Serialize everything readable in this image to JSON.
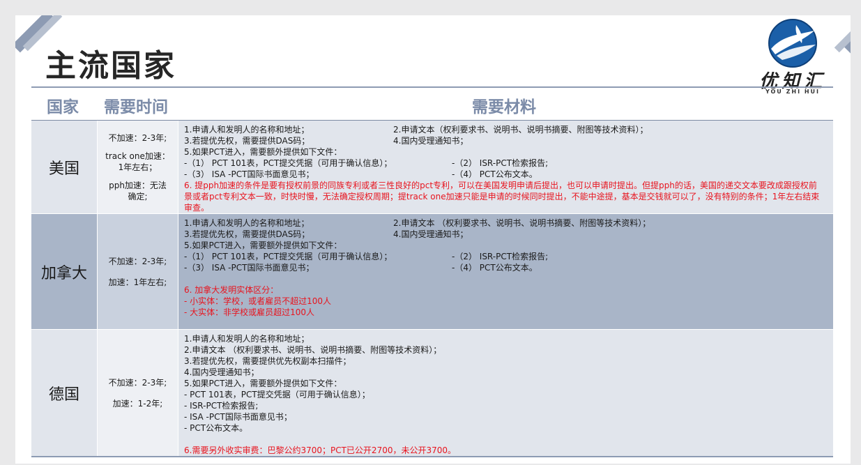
{
  "title": "主流国家",
  "logo": {
    "text": "优知汇",
    "sub": "YOU ZHI HUI"
  },
  "header": {
    "country": "国家",
    "time": "需要时间",
    "materials": "需要材料"
  },
  "rows": {
    "us": {
      "country": "美国",
      "time": [
        "不加速：2-3年;",
        "track one加速：",
        "1年左右；",
        "pph加速：无法",
        "确定;"
      ],
      "lines": [
        [
          "1.申请人和发明人的名称和地址；",
          "2.申请文本（权利要求书、说明书、说明书摘要、附图等技术资料）；"
        ],
        [
          "3.若提优先权，需要提供DAS码；",
          "4.国内受理通知书；"
        ],
        [
          "5.如果PCT进入，需要额外提供如下文件：",
          ""
        ],
        [
          " -（1） PCT 101表，PCT提交凭据（可用于确认信息）；",
          "-（2） ISR-PCT检索报告;"
        ],
        [
          " -（3） ISA -PCT国际书面意见书；",
          "-（4） PCT公布文本。"
        ]
      ],
      "note": "6. 提pph加速的条件是要有授权前景的同族专利或者三性良好的pct专利，可以在美国发明申请后提出，也可以申请时提出。但提pph的话，美国的递交文本要改成跟授权前景或者pct专利文本一致，时快时慢，无法确定授权周期；提track one加速只能是申请的时候同时提出，不能中途提，基本是交钱就可以了，没有特别的条件；1年左右结束审查。"
    },
    "ca": {
      "country": "加拿大",
      "time": [
        "不加速：2-3年;",
        "加速：1年左右;"
      ],
      "lines": [
        [
          "1.申请人和发明人的名称和地址；",
          "2.申请文本 （权利要求书、说明书、说明书摘要、附图等技术资料）；"
        ],
        [
          "3.若提优先权，需要提供DAS码；",
          "4.国内受理通知书；"
        ],
        [
          "5.如果PCT进入，需要额外提供如下文件：",
          ""
        ],
        [
          " -（1） PCT 101表，PCT提交凭据（可用于确认信息）；",
          "-（2） ISR-PCT检索报告;"
        ],
        [
          " -（3） ISA -PCT国际书面意见书；",
          "-（4） PCT公布文本。"
        ]
      ],
      "notes": [
        "6. 加拿大发明实体区分：",
        "- 小实体：学校，或者雇员不超过100人",
        "- 大实体：非学校或雇员超过100人"
      ]
    },
    "de": {
      "country": "德国",
      "time": [
        "不加速：2-3年;",
        "加速：1-2年;"
      ],
      "lines": [
        "1.申请人和发明人的名称和地址；",
        "2.申请文本 （权利要求书、说明书、说明书摘要、附图等技术资料）；",
        "3.若提优先权，需要提供优先权副本扫描件；",
        "4.国内受理通知书；",
        "5.如果PCT进入，需要额外提供如下文件：",
        " - PCT 101表，PCT提交凭据（可用于确认信息）；",
        " - ISR-PCT检索报告;",
        " - ISA -PCT国际书面意见书；",
        " - PCT公布文本。"
      ],
      "note": "6.需要另外收实审费：巴黎公约3700；PCT已公开2700，未公开3700。"
    }
  },
  "colors": {
    "accent": "#7b8ba8",
    "red": "#e8141e",
    "band_dark": "#a9b5c8",
    "band_light": "#e1e5ec"
  }
}
